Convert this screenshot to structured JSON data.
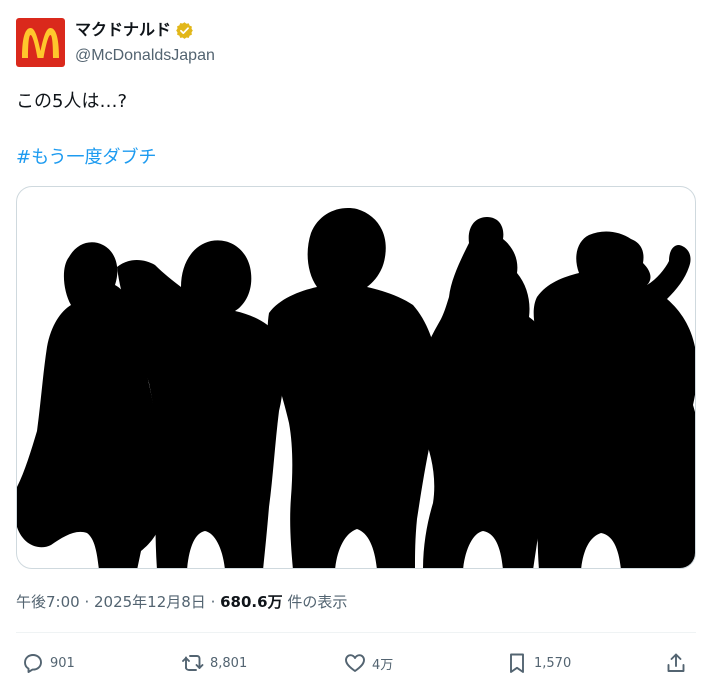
{
  "account": {
    "display_name": "マクドナルド",
    "handle": "@McDonaldsJapan",
    "verified": true
  },
  "tweet": {
    "text": "この5人は…?",
    "hashtag": "#もう一度ダブチ",
    "image": {
      "content": "five-character-silhouettes"
    }
  },
  "meta": {
    "time": "午後7:00",
    "separator1": " · ",
    "date": "2025年12月8日",
    "separator2": " · ",
    "views": "680.6万",
    "views_label": " 件の表示"
  },
  "actions": {
    "replies": "901",
    "reposts": "8,801",
    "likes": "4万",
    "bookmarks": "1,570"
  },
  "colors": {
    "brand_red": "#da291c",
    "brand_yellow": "#ffc72c",
    "link_blue": "#1d9bf0",
    "verified_gold": "#e2b719",
    "muted": "#536471"
  }
}
